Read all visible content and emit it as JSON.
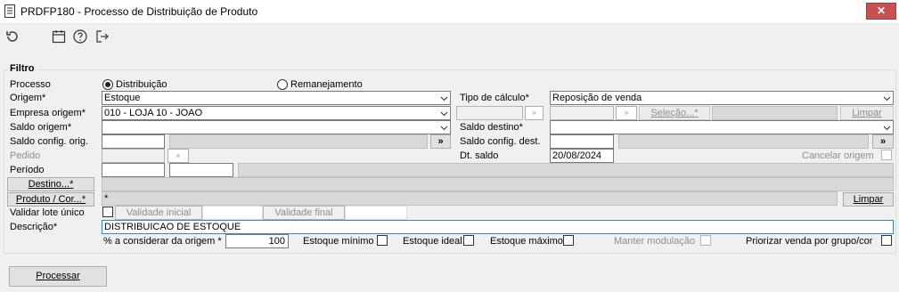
{
  "window": {
    "title": "PRDFP180 - Processo de Distribuição de Produto",
    "close_label": "✕"
  },
  "toolbar": {
    "icons": [
      "undo-icon",
      "calendar-icon",
      "help-icon",
      "exit-icon"
    ]
  },
  "filter": {
    "legend": "Filtro",
    "processo_label": "Processo",
    "radio_distribuicao": "Distribuição",
    "radio_remanejamento": "Remanejamento",
    "selected_process": "Distribuição",
    "origem_label": "Origem*",
    "origem_value": "Estoque",
    "empresa_origem_label": "Empresa origem*",
    "empresa_origem_value": "010 - LOJA 10 - JOAO",
    "saldo_origem_label": "Saldo origem*",
    "saldo_origem_value": "",
    "saldo_config_orig_label": "Saldo config. orig.",
    "saldo_config_orig_value": "",
    "pedido_label": "Pedido",
    "periodo_label": "Período",
    "destino_button": "Destino...*",
    "produto_cor_button": "Produto / Cor...*",
    "produto_cor_value": "*",
    "limpar_button": "Limpar",
    "validar_lote_label": "Validar lote único",
    "validade_inicial_label": "Validade inicial",
    "validade_final_label": "Validade final",
    "descricao_label": "Descrição*",
    "descricao_value": "DISTRIBUICAO DE ESTOQUE",
    "pct_origem_label": "% a considerar da origem *",
    "pct_origem_value": "100",
    "estoque_minimo_label": "Estoque mínimo",
    "estoque_ideal_label": "Estoque ideal",
    "estoque_maximo_label": "Estoque máximo",
    "manter_modulacao_label": "Manter modulação",
    "priorizar_label": "Priorizar venda por grupo/cor",
    "tipo_calculo_label": "Tipo de cálculo*",
    "tipo_calculo_value": "Reposição de venda",
    "selecao_button": "Seleção...*",
    "limpar_top_button": "Limpar",
    "saldo_destino_label": "Saldo destino*",
    "saldo_destino_value": "",
    "saldo_config_dest_label": "Saldo config. dest.",
    "dt_saldo_label": "Dt. saldo",
    "dt_saldo_value": "20/08/2024",
    "cancelar_origem_label": "Cancelar origem",
    "more_button": "»",
    "lookup_glyph": "»"
  },
  "footer": {
    "processar_button": "Processar"
  }
}
